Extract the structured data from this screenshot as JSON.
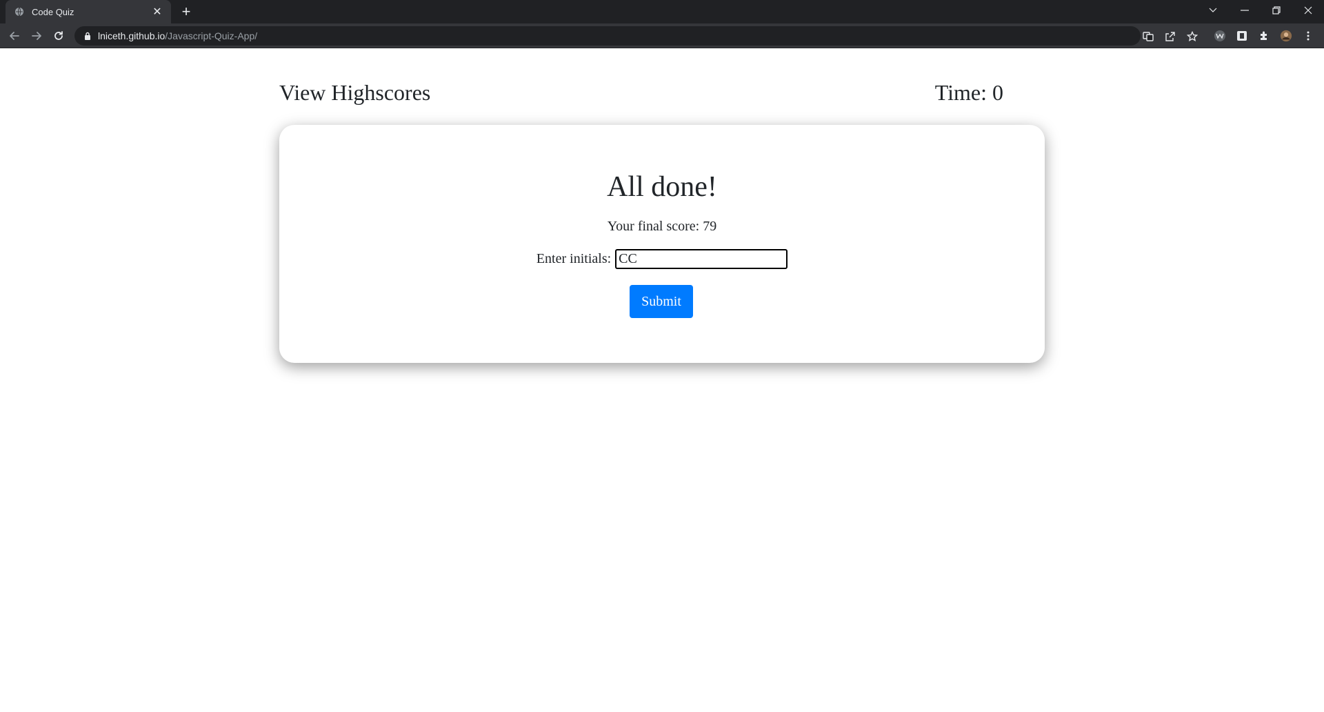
{
  "browser": {
    "tab_title": "Code Quiz",
    "url_host": "lniceth.github.io",
    "url_path": "/Javascript-Quiz-App/"
  },
  "header": {
    "view_highscores": "View Highscores",
    "time_label": "Time: ",
    "time_value": "0"
  },
  "card": {
    "title": "All done!",
    "score_label": "Your final score: ",
    "score_value": "79",
    "initials_label": "Enter initials:",
    "initials_value": "CC",
    "submit_label": "Submit"
  },
  "colors": {
    "submit_button": "#007bff",
    "tabstrip": "#202124",
    "toolbar": "#35363a"
  }
}
